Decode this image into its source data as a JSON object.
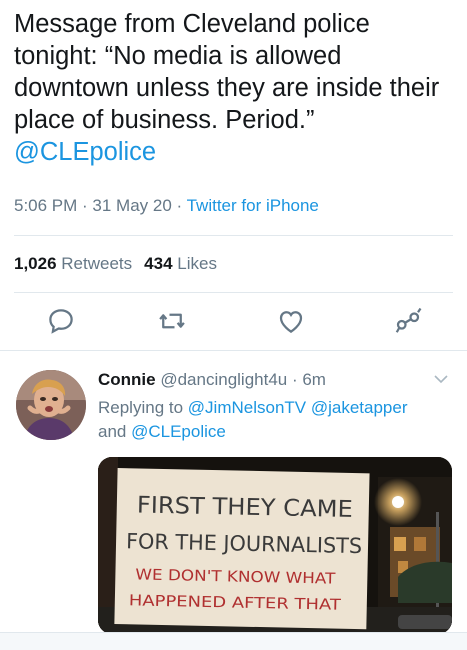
{
  "tweet": {
    "text": "Message from Cleveland police tonight: “No media is allowed downtown unless they are inside their place of business. Period.”",
    "mention": "@CLEpolice",
    "time": "5:06 PM · 31 May 20 · ",
    "source": "Twitter for iPhone",
    "retweets_count": "1,026",
    "retweets_label": "Retweets",
    "likes_count": "434",
    "likes_label": "Likes"
  },
  "actions": {
    "icons": [
      "reply-icon",
      "retweet-icon",
      "like-icon",
      "share-icon"
    ]
  },
  "reply": {
    "name": "Connie",
    "handle": "@dancinglight4u",
    "time": " · 6m",
    "replying_prefix": "Replying to ",
    "replying_to_1": "@JimNelsonTV",
    "replying_to_2": "@jaketapper",
    "replying_and": "and ",
    "replying_to_3": "@CLEpolice",
    "sign": {
      "line1": "FIRST THEY CAME",
      "line2": "FOR THE JOURNALISTS",
      "line3": "WE DON'T KNOW WHAT",
      "line4": "HAPPENED AFTER THAT"
    }
  },
  "colors": {
    "link": "#1b95e0",
    "secondary": "#657786",
    "text": "#14171a"
  }
}
